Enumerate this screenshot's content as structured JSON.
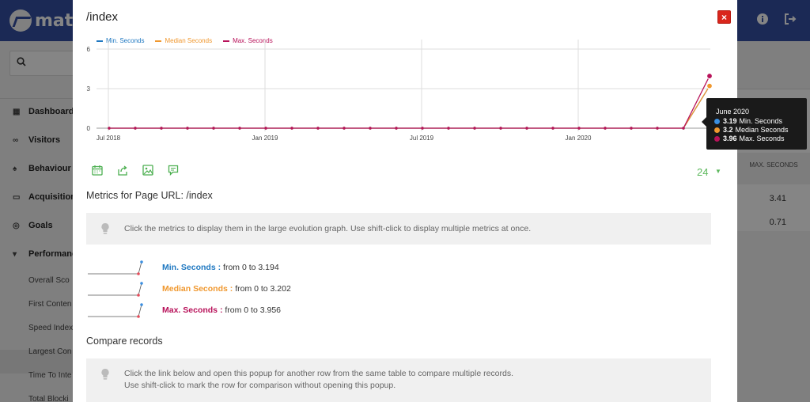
{
  "app": {
    "logo_text": "mato",
    "search_icon": "search-icon",
    "sidebar": {
      "items": [
        {
          "icon": "grid-icon",
          "label": "Dashboard"
        },
        {
          "icon": "binoculars-icon",
          "label": "Visitors"
        },
        {
          "icon": "bell-icon",
          "label": "Behaviour"
        },
        {
          "icon": "window-icon",
          "label": "Acquisition"
        },
        {
          "icon": "target-icon",
          "label": "Goals"
        },
        {
          "icon": "caret-down-icon",
          "label": "Performance"
        }
      ],
      "sub_items": [
        "Overall Sco",
        "First Conten",
        "Speed Index",
        "Largest Con",
        "Time To Inte",
        "Total Blocki"
      ]
    },
    "table": {
      "header": "MAX. SECONDS",
      "values": [
        "3.41",
        "0.71"
      ]
    }
  },
  "modal": {
    "title": "/index",
    "close_label": "×",
    "legend": [
      {
        "name": "Min. Seconds",
        "color": "#1f78c1"
      },
      {
        "name": "Median Seconds",
        "color": "#f0982f"
      },
      {
        "name": "Max. Seconds",
        "color": "#b8125a"
      }
    ],
    "period_value": "24",
    "period_caret": "▼",
    "metrics_heading": "Metrics for Page URL: /index",
    "metrics_hint": "Click the metrics to display them in the large evolution graph. Use shift-click to display multiple metrics at once.",
    "metrics": [
      {
        "name": "Min. Seconds",
        "sep": ":",
        "range": "from 0 to 3.194",
        "color": "#1f78c1"
      },
      {
        "name": "Median Seconds",
        "sep": ":",
        "range": "from 0 to 3.202",
        "color": "#f0982f"
      },
      {
        "name": "Max. Seconds",
        "sep": ":",
        "range": "from 0 to 3.956",
        "color": "#b8125a"
      }
    ],
    "compare_heading": "Compare records",
    "compare_hint_1": "Click the link below and open this popup for another row from the same table to compare multiple records.",
    "compare_hint_2": "Use shift-click to mark the row for comparison without opening this popup.",
    "tooltip": {
      "title": "June 2020",
      "rows": [
        {
          "value": "3.19",
          "name": "Min. Seconds",
          "color": "#1f78c1"
        },
        {
          "value": "3.2",
          "name": "Median Seconds",
          "color": "#f0982f"
        },
        {
          "value": "3.96",
          "name": "Max. Seconds",
          "color": "#b8125a"
        }
      ]
    }
  },
  "chart_data": {
    "type": "line",
    "x_tick_labels": [
      "Jul 2018",
      "Jan 2019",
      "Jul 2019",
      "Jan 2020"
    ],
    "y_tick_labels": [
      "0",
      "3",
      "6"
    ],
    "ylim": [
      0,
      6
    ],
    "grid": true,
    "legend_position": "top-left",
    "x": [
      "2018-07",
      "2018-08",
      "2018-09",
      "2018-10",
      "2018-11",
      "2018-12",
      "2019-01",
      "2019-02",
      "2019-03",
      "2019-04",
      "2019-05",
      "2019-06",
      "2019-07",
      "2019-08",
      "2019-09",
      "2019-10",
      "2019-11",
      "2019-12",
      "2020-01",
      "2020-02",
      "2020-03",
      "2020-04",
      "2020-05",
      "2020-06"
    ],
    "series": [
      {
        "name": "Min. Seconds",
        "color": "#1f78c1",
        "values": [
          0,
          0,
          0,
          0,
          0,
          0,
          0,
          0,
          0,
          0,
          0,
          0,
          0,
          0,
          0,
          0,
          0,
          0,
          0,
          0,
          0,
          0,
          0,
          3.194
        ]
      },
      {
        "name": "Median Seconds",
        "color": "#f0982f",
        "values": [
          0,
          0,
          0,
          0,
          0,
          0,
          0,
          0,
          0,
          0,
          0,
          0,
          0,
          0,
          0,
          0,
          0,
          0,
          0,
          0,
          0,
          0,
          0,
          3.202
        ]
      },
      {
        "name": "Max. Seconds",
        "color": "#b8125a",
        "values": [
          0,
          0,
          0,
          0,
          0,
          0,
          0,
          0,
          0,
          0,
          0,
          0,
          0,
          0,
          0,
          0,
          0,
          0,
          0,
          0,
          0,
          0,
          0,
          3.956
        ]
      }
    ]
  }
}
